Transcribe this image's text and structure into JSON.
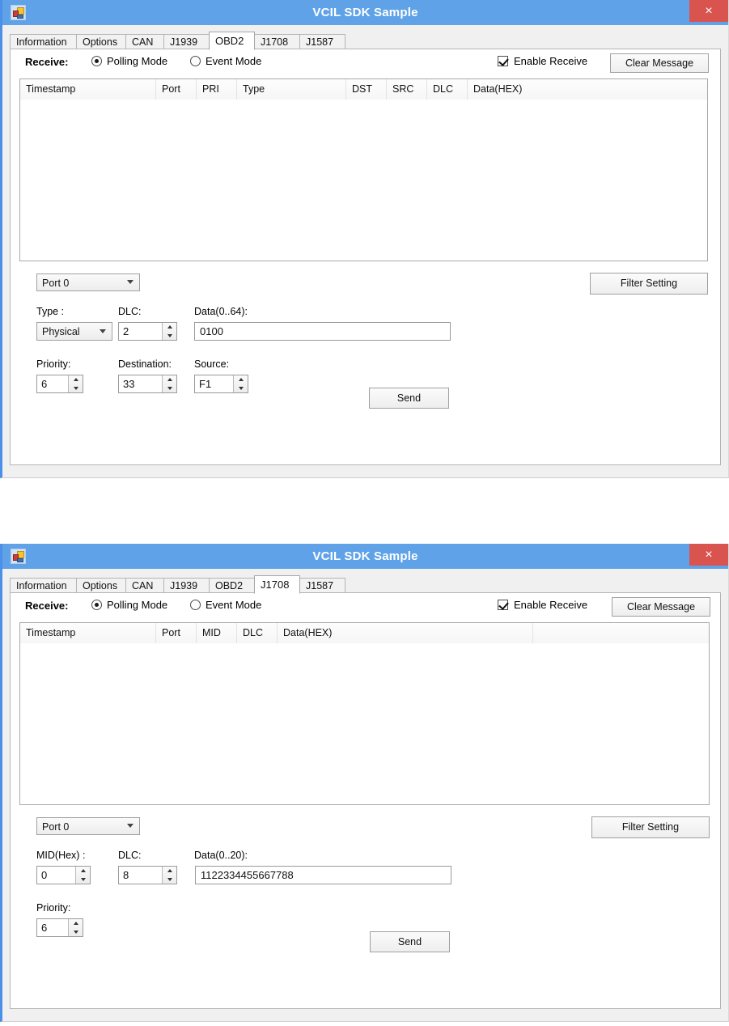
{
  "app": {
    "title": "VCIL SDK Sample",
    "close_label": "×",
    "icon": "vb-form-icon",
    "title_bar_color": "#5fa2e8",
    "close_button_color": "#d9534f"
  },
  "tabs": [
    {
      "label": "Information"
    },
    {
      "label": "Options"
    },
    {
      "label": "CAN"
    },
    {
      "label": "J1939"
    },
    {
      "label": "OBD2"
    },
    {
      "label": "J1708"
    },
    {
      "label": "J1587"
    }
  ],
  "receive": {
    "label": "Receive:",
    "polling_label": "Polling Mode",
    "event_label": "Event Mode",
    "polling_selected": true,
    "event_selected": false,
    "enable_receive_label": "Enable Receive",
    "enable_receive_checked": true,
    "clear_message_label": "Clear Message"
  },
  "common": {
    "filter_setting_label": "Filter Setting",
    "send_label": "Send",
    "port_value": "Port 0"
  },
  "window1": {
    "active_tab": "OBD2",
    "grid_columns": [
      "Timestamp",
      "Port",
      "PRI",
      "Type",
      "DST",
      "SRC",
      "DLC",
      "Data(HEX)"
    ],
    "grid_rows": [],
    "fields": {
      "type_label": "Type :",
      "type_value": "Physical",
      "dlc_label": "DLC:",
      "dlc_value": "2",
      "data_label": "Data(0..64):",
      "data_value": "0100",
      "priority_label": "Priority:",
      "priority_value": "6",
      "destination_label": "Destination:",
      "destination_value": "33",
      "source_label": "Source:",
      "source_value": "F1"
    }
  },
  "window2": {
    "active_tab": "J1708",
    "grid_columns": [
      "Timestamp",
      "Port",
      "MID",
      "DLC",
      "Data(HEX)"
    ],
    "grid_rows": [],
    "fields": {
      "mid_label": "MID(Hex) :",
      "mid_value": "0",
      "dlc_label": "DLC:",
      "dlc_value": "8",
      "data_label": "Data(0..20):",
      "data_value": "1122334455667788",
      "priority_label": "Priority:",
      "priority_value": "6"
    }
  }
}
